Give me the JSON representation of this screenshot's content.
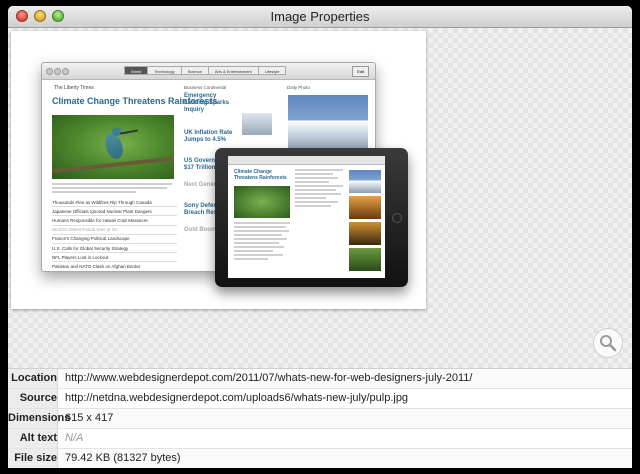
{
  "window": {
    "title": "Image Properties"
  },
  "preview_image": {
    "desktop": {
      "tabs": [
        "World",
        "Technology",
        "Science",
        "Arts & Entertainment",
        "Lifestyle"
      ],
      "edit_label": "Edit",
      "masthead": "The Liberty Times",
      "headline": "Climate Change Threatens Rainforests",
      "section_business": "Business Continental",
      "section_daily_photo": "Daily Photo",
      "col2_headlines": [
        "Emergency Landing Sparks Inquiry",
        "UK Inflation Rate Jumps to 4.5%",
        "US Government $17 Trillion D"
      ],
      "col2_headlines_more": [
        "Next Generation",
        "Sony Defends Breach Response",
        "Gold Boom Reo"
      ],
      "list": [
        "Thousands Flee as Wildfires Rip Through Canada",
        "Japanese Officials Ignored Nuclear Plant Dangers",
        "Humans Responsible for Hawaii Crab Massacre",
        "World's Oldest Panda Dies at 25",
        "France's Changing Political Landscape",
        "U.S. Calls for Global Security Strategy",
        "NFL Players Lost in Lockout",
        "Pakistan and NATO Clash on Afghan Border"
      ]
    },
    "ipad": {
      "headline": "Climate Change Threatens Rainforests"
    }
  },
  "zoom": {
    "icon": "magnifier-icon"
  },
  "properties": [
    {
      "label": "Location",
      "value": "http://www.webdesignerdepot.com/2011/07/whats-new-for-web-designers-july-2011/"
    },
    {
      "label": "Source",
      "value": "http://netdna.webdesignerdepot.com/uploads6/whats-new-july/pulp.jpg"
    },
    {
      "label": "Dimensions",
      "value": "615 x 417"
    },
    {
      "label": "Alt text",
      "value": "N/A"
    },
    {
      "label": "File size",
      "value": "79.42 KB (81327 bytes)"
    }
  ],
  "colors": {
    "window_bg": "#f7f7f7",
    "label_bg": "#ececec",
    "headline_blue": "#2a6a8f",
    "close": "#e0443b",
    "minimize": "#e0a62b",
    "zoom": "#5fb93a"
  }
}
